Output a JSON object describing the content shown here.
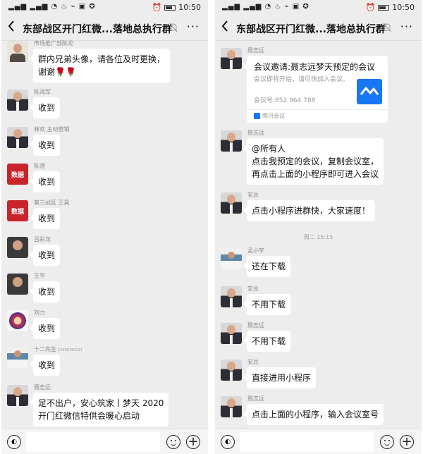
{
  "status": {
    "left_icons": "▂▄▆ ▂▄▆ ◔ ♨ ⌁ ▣ ✪",
    "time": "10:50"
  },
  "colors": {
    "accent": "#1878f3",
    "bubble_bg": "#ffffff",
    "chat_bg": "#ededed",
    "avatar_red": "#c9242b"
  },
  "chat": {
    "title": "东部战区开门红微...落地总执行群",
    "icons": {
      "back": "back-chevron-icon",
      "mute": "muted-bell-icon",
      "more": "more-dots-icon",
      "voice": "voice-icon",
      "emoji": "emoji-icon",
      "plus": "plus-icon"
    },
    "more_label": "···"
  },
  "left_messages": [
    {
      "sender": "市场推广部陈龙",
      "lines": [
        "群内兄弟头像，请各位及时更换，",
        "谢谢🌹🌹"
      ]
    },
    {
      "sender": "陈海军",
      "lines": [
        "收到"
      ]
    },
    {
      "sender": "林欢 主动营销",
      "lines": [
        "收到"
      ]
    },
    {
      "sender": "陈澄",
      "lines": [
        "收到"
      ]
    },
    {
      "sender": "第三战区 王昊",
      "lines": [
        "收到"
      ]
    },
    {
      "sender": "吕彩龙",
      "lines": [
        "收到"
      ]
    },
    {
      "sender": "王平",
      "lines": [
        "收到"
      ]
    },
    {
      "sender": "刘力",
      "lines": [
        "收到"
      ]
    },
    {
      "sender": "十二先生",
      "phone": "15356789211",
      "lines": [
        "收到"
      ]
    },
    {
      "sender": "聂志远",
      "lines": [
        "足不出户，安心筑家丨梦天 2020",
        "开门红微信特供会暖心启动"
      ]
    }
  ],
  "red_avatar_text": "数据",
  "meeting": {
    "sender": "聂志远",
    "title": "会议邀请:聂志远梦天预定的会议",
    "desc": "会议即将开始，请尽快加入会议。",
    "number": "会议号:852 964 788",
    "source": "腾讯会议"
  },
  "right_messages": [
    {
      "sender": "聂志远",
      "lines": [
        "@所有人",
        "点击我预定的会议，复制会议室，",
        "再点击上面的小程序即可进入会议"
      ]
    },
    {
      "sender": "安总",
      "lines": [
        "点击小程序进群快，大家速度！"
      ]
    },
    {
      "sender": "孟小宇",
      "lines": [
        "还在下载"
      ]
    },
    {
      "sender": "安总",
      "lines": [
        "不用下载"
      ]
    },
    {
      "sender": "聂志远",
      "lines": [
        "不用下载"
      ]
    },
    {
      "sender": "安总",
      "lines": [
        "直接进用小程序"
      ]
    },
    {
      "sender": "聂志远",
      "lines": [
        "点击上面的小程序，输入会议室号"
      ]
    }
  ],
  "timestamp": "周二 15:15"
}
